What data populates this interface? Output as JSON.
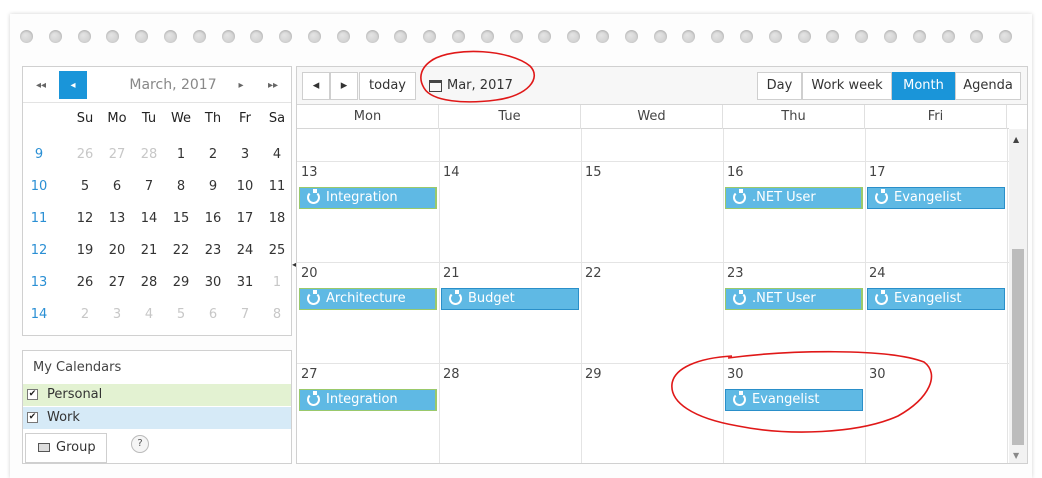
{
  "mini": {
    "title": "March, 2017",
    "nav": {
      "first": "◂◂",
      "prev": "◂",
      "next": "▸",
      "last": "▸▸"
    },
    "dow": [
      "Su",
      "Mo",
      "Tu",
      "We",
      "Th",
      "Fr",
      "Sa"
    ],
    "weeks": [
      {
        "num": "9",
        "days": [
          "26",
          "27",
          "28",
          "1",
          "2",
          "3",
          "4"
        ]
      },
      {
        "num": "10",
        "days": [
          "5",
          "6",
          "7",
          "8",
          "9",
          "10",
          "11"
        ]
      },
      {
        "num": "11",
        "days": [
          "12",
          "13",
          "14",
          "15",
          "16",
          "17",
          "18"
        ]
      },
      {
        "num": "12",
        "days": [
          "19",
          "20",
          "21",
          "22",
          "23",
          "24",
          "25"
        ]
      },
      {
        "num": "13",
        "days": [
          "26",
          "27",
          "28",
          "29",
          "30",
          "31",
          "1"
        ]
      },
      {
        "num": "14",
        "days": [
          "2",
          "3",
          "4",
          "5",
          "6",
          "7",
          "8"
        ]
      }
    ]
  },
  "calendars": {
    "title": "My Calendars",
    "items": [
      {
        "label": "Personal",
        "checked": "✔",
        "color": "#e3f2d2"
      },
      {
        "label": "Work",
        "checked": "✔",
        "color": "#d6eaf7"
      }
    ],
    "group_label": "Group",
    "help": "?"
  },
  "toolbar": {
    "prev": "◂",
    "next": "▸",
    "today": "today",
    "date": "Mar, 2017",
    "views": [
      "Day",
      "Work week",
      "Month",
      "Agenda"
    ],
    "selected_view": "Month"
  },
  "days": [
    "Mon",
    "Tue",
    "Wed",
    "Thu",
    "Fri"
  ],
  "weeks": [
    {
      "dates": [
        "13",
        "14",
        "15",
        "16",
        "17"
      ]
    },
    {
      "dates": [
        "20",
        "21",
        "22",
        "23",
        "24"
      ]
    },
    {
      "dates": [
        "27",
        "28",
        "29",
        "30",
        "30"
      ]
    }
  ],
  "events": [
    {
      "title": "Integration",
      "week": 0,
      "day": 0,
      "calendar": "personal"
    },
    {
      "title": ".NET User",
      "week": 0,
      "day": 3,
      "calendar": "personal"
    },
    {
      "title": "Evangelist",
      "week": 0,
      "day": 4,
      "calendar": "work"
    },
    {
      "title": "Architecture",
      "week": 1,
      "day": 0,
      "calendar": "personal"
    },
    {
      "title": "Budget",
      "week": 1,
      "day": 1,
      "calendar": "work"
    },
    {
      "title": ".NET User",
      "week": 1,
      "day": 3,
      "calendar": "personal"
    },
    {
      "title": "Evangelist",
      "week": 1,
      "day": 4,
      "calendar": "work"
    },
    {
      "title": "Integration",
      "week": 2,
      "day": 0,
      "calendar": "personal"
    },
    {
      "title": "Evangelist",
      "week": 2,
      "day": 3,
      "calendar": "work"
    }
  ],
  "colors": {
    "accent": "#1a95d9",
    "event": "#5fb9e4",
    "annotation": "#e01818"
  }
}
